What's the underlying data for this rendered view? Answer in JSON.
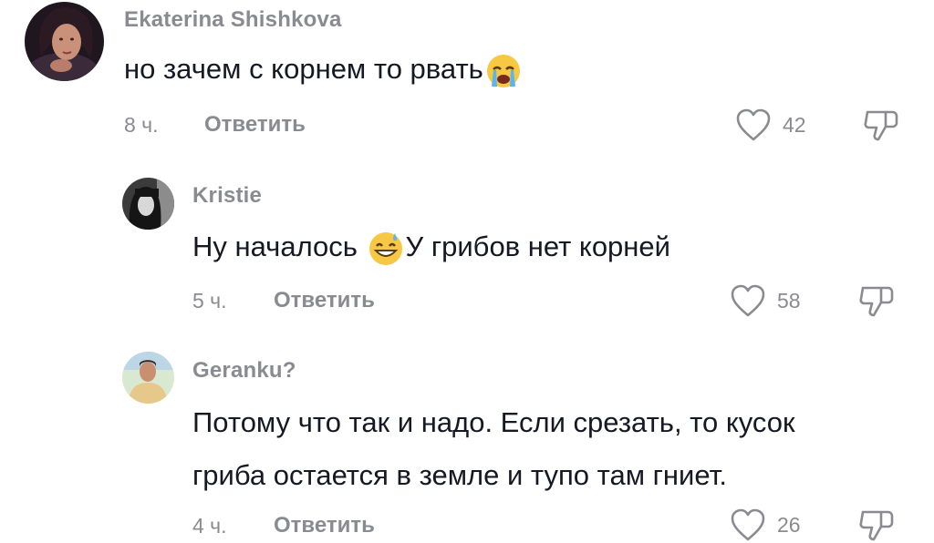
{
  "comments": [
    {
      "username": "Ekaterina Shishkova",
      "text_before": "но зачем с корнем то рвать",
      "emoji": "loudly-crying-face-emoji",
      "text_after": "",
      "time": "8 ч.",
      "reply_label": "Ответить",
      "likes": "42",
      "avatar": "avatar-woman-photo"
    },
    {
      "username": "Kristie",
      "text_before": "Ну началось ",
      "emoji": "grinning-sweat-face-emoji",
      "text_after": "У грибов нет корней",
      "time": "5 ч.",
      "reply_label": "Ответить",
      "likes": "58",
      "avatar": "avatar-woman-bw-photo"
    },
    {
      "username": "Geranku?",
      "text_line1": "Потому что так и надо. Если срезать, то кусок",
      "text_line2": "гриба остается в земле и тупо там гниет.",
      "time": "4 ч.",
      "reply_label": "Ответить",
      "likes": "26",
      "avatar": "avatar-man-photo"
    }
  ],
  "icons": {
    "like": "heart-outline-icon",
    "dislike": "thumbs-down-outline-icon"
  },
  "colors": {
    "text": "#161823",
    "muted": "#8a8b91",
    "background": "#ffffff"
  }
}
